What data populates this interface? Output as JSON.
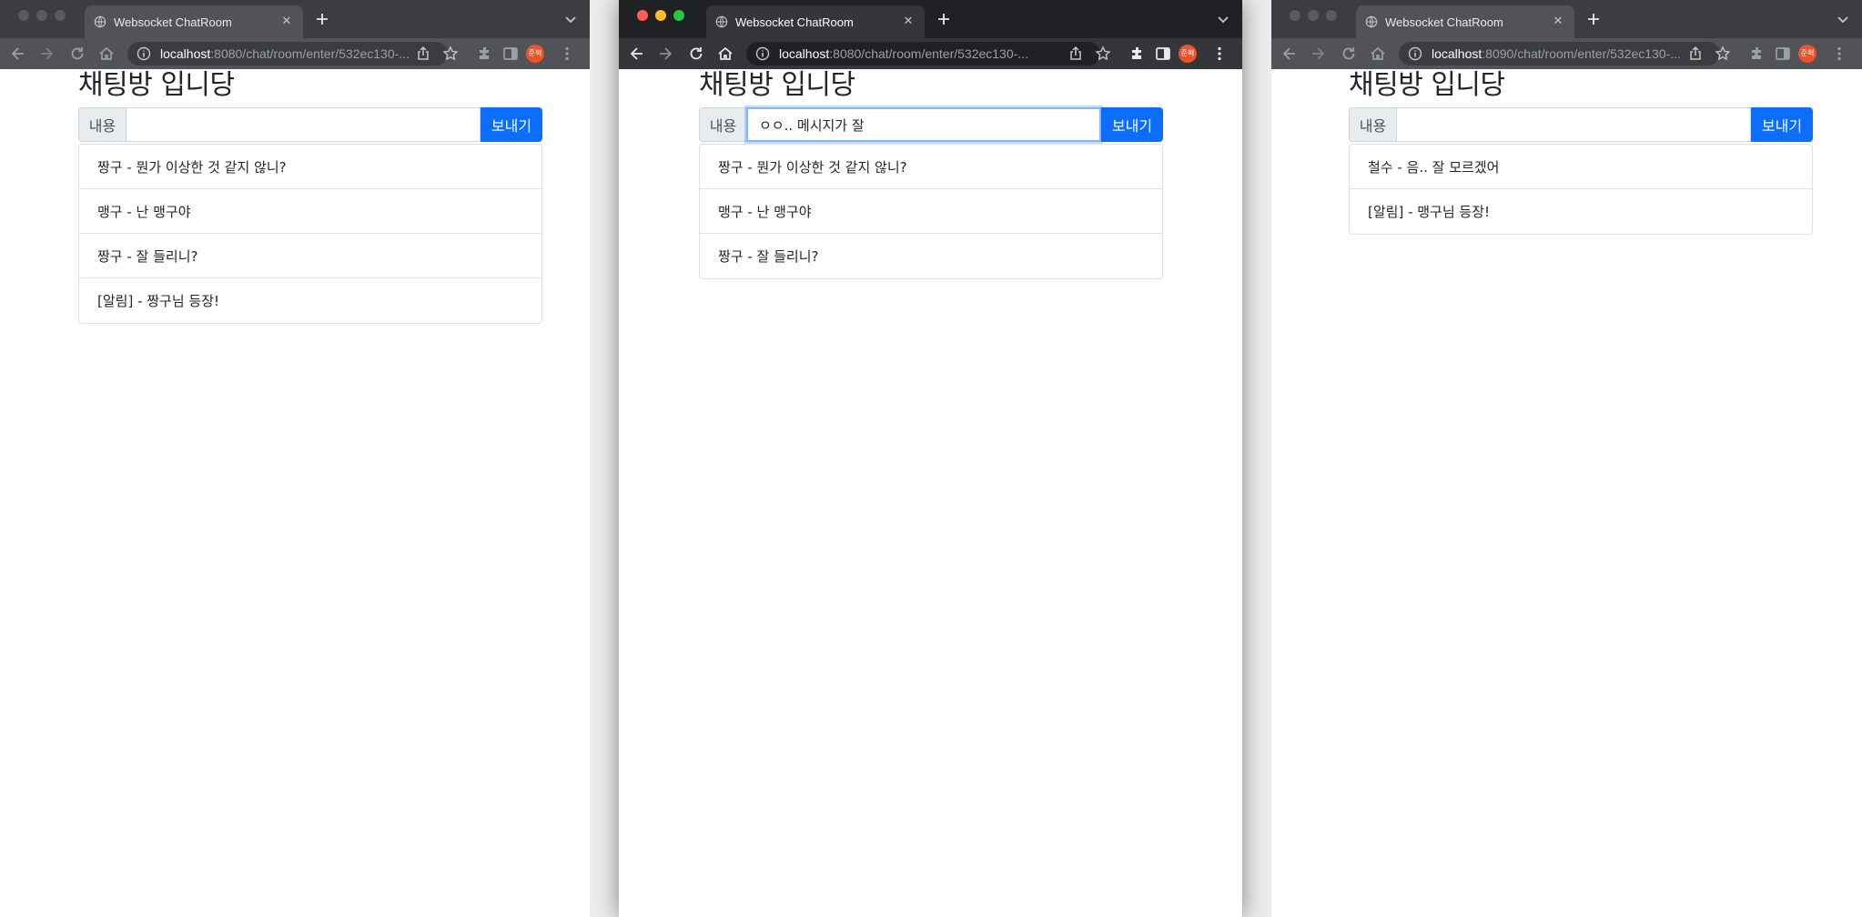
{
  "windows": [
    {
      "tab_title": "Websocket ChatRoom",
      "url_host": "localhost",
      "url_rest": ":8080/chat/room/enter/532ec130-...",
      "avatar_text": "준혁",
      "heading": "채팅방 입니당",
      "input_label": "내용",
      "input_value": "",
      "send_label": "보내기",
      "messages": [
        "짱구 - 뭔가 이상한 것 같지 않니?",
        "맹구 - 난 맹구야",
        "짱구 - 잘 들리니?",
        "[알림] - 짱구님 등장!"
      ]
    },
    {
      "tab_title": "Websocket ChatRoom",
      "url_host": "localhost",
      "url_rest": ":8080/chat/room/enter/532ec130-...",
      "avatar_text": "준혁",
      "heading": "채팅방 입니당",
      "input_label": "내용",
      "input_value": "ㅇㅇ.. 메시지가 잘 ",
      "send_label": "보내기",
      "messages": [
        "짱구 - 뭔가 이상한 것 같지 않니?",
        "맹구 - 난 맹구야",
        "짱구 - 잘 들리니?"
      ]
    },
    {
      "tab_title": "Websocket ChatRoom",
      "url_host": "localhost",
      "url_rest": ":8090/chat/room/enter/532ec130-...",
      "avatar_text": "준혁",
      "heading": "채팅방 입니당",
      "input_label": "내용",
      "input_value": "",
      "send_label": "보내기",
      "messages": [
        "철수 - 음.. 잘 모르겠어",
        "[알림] - 맹구님 등장!"
      ]
    }
  ],
  "colors": {
    "send_button": "#0d6efd",
    "active_tabstrip": "#202124",
    "inactive_tabstrip": "#3c3d41",
    "avatar": "#e8542b"
  },
  "icons": [
    "globe-icon",
    "close-icon",
    "plus-icon",
    "chevron-down-icon",
    "back-arrow-icon",
    "forward-arrow-icon",
    "reload-icon",
    "home-icon",
    "info-icon",
    "share-icon",
    "star-icon",
    "extensions-icon",
    "side-panel-icon",
    "kebab-menu-icon"
  ]
}
